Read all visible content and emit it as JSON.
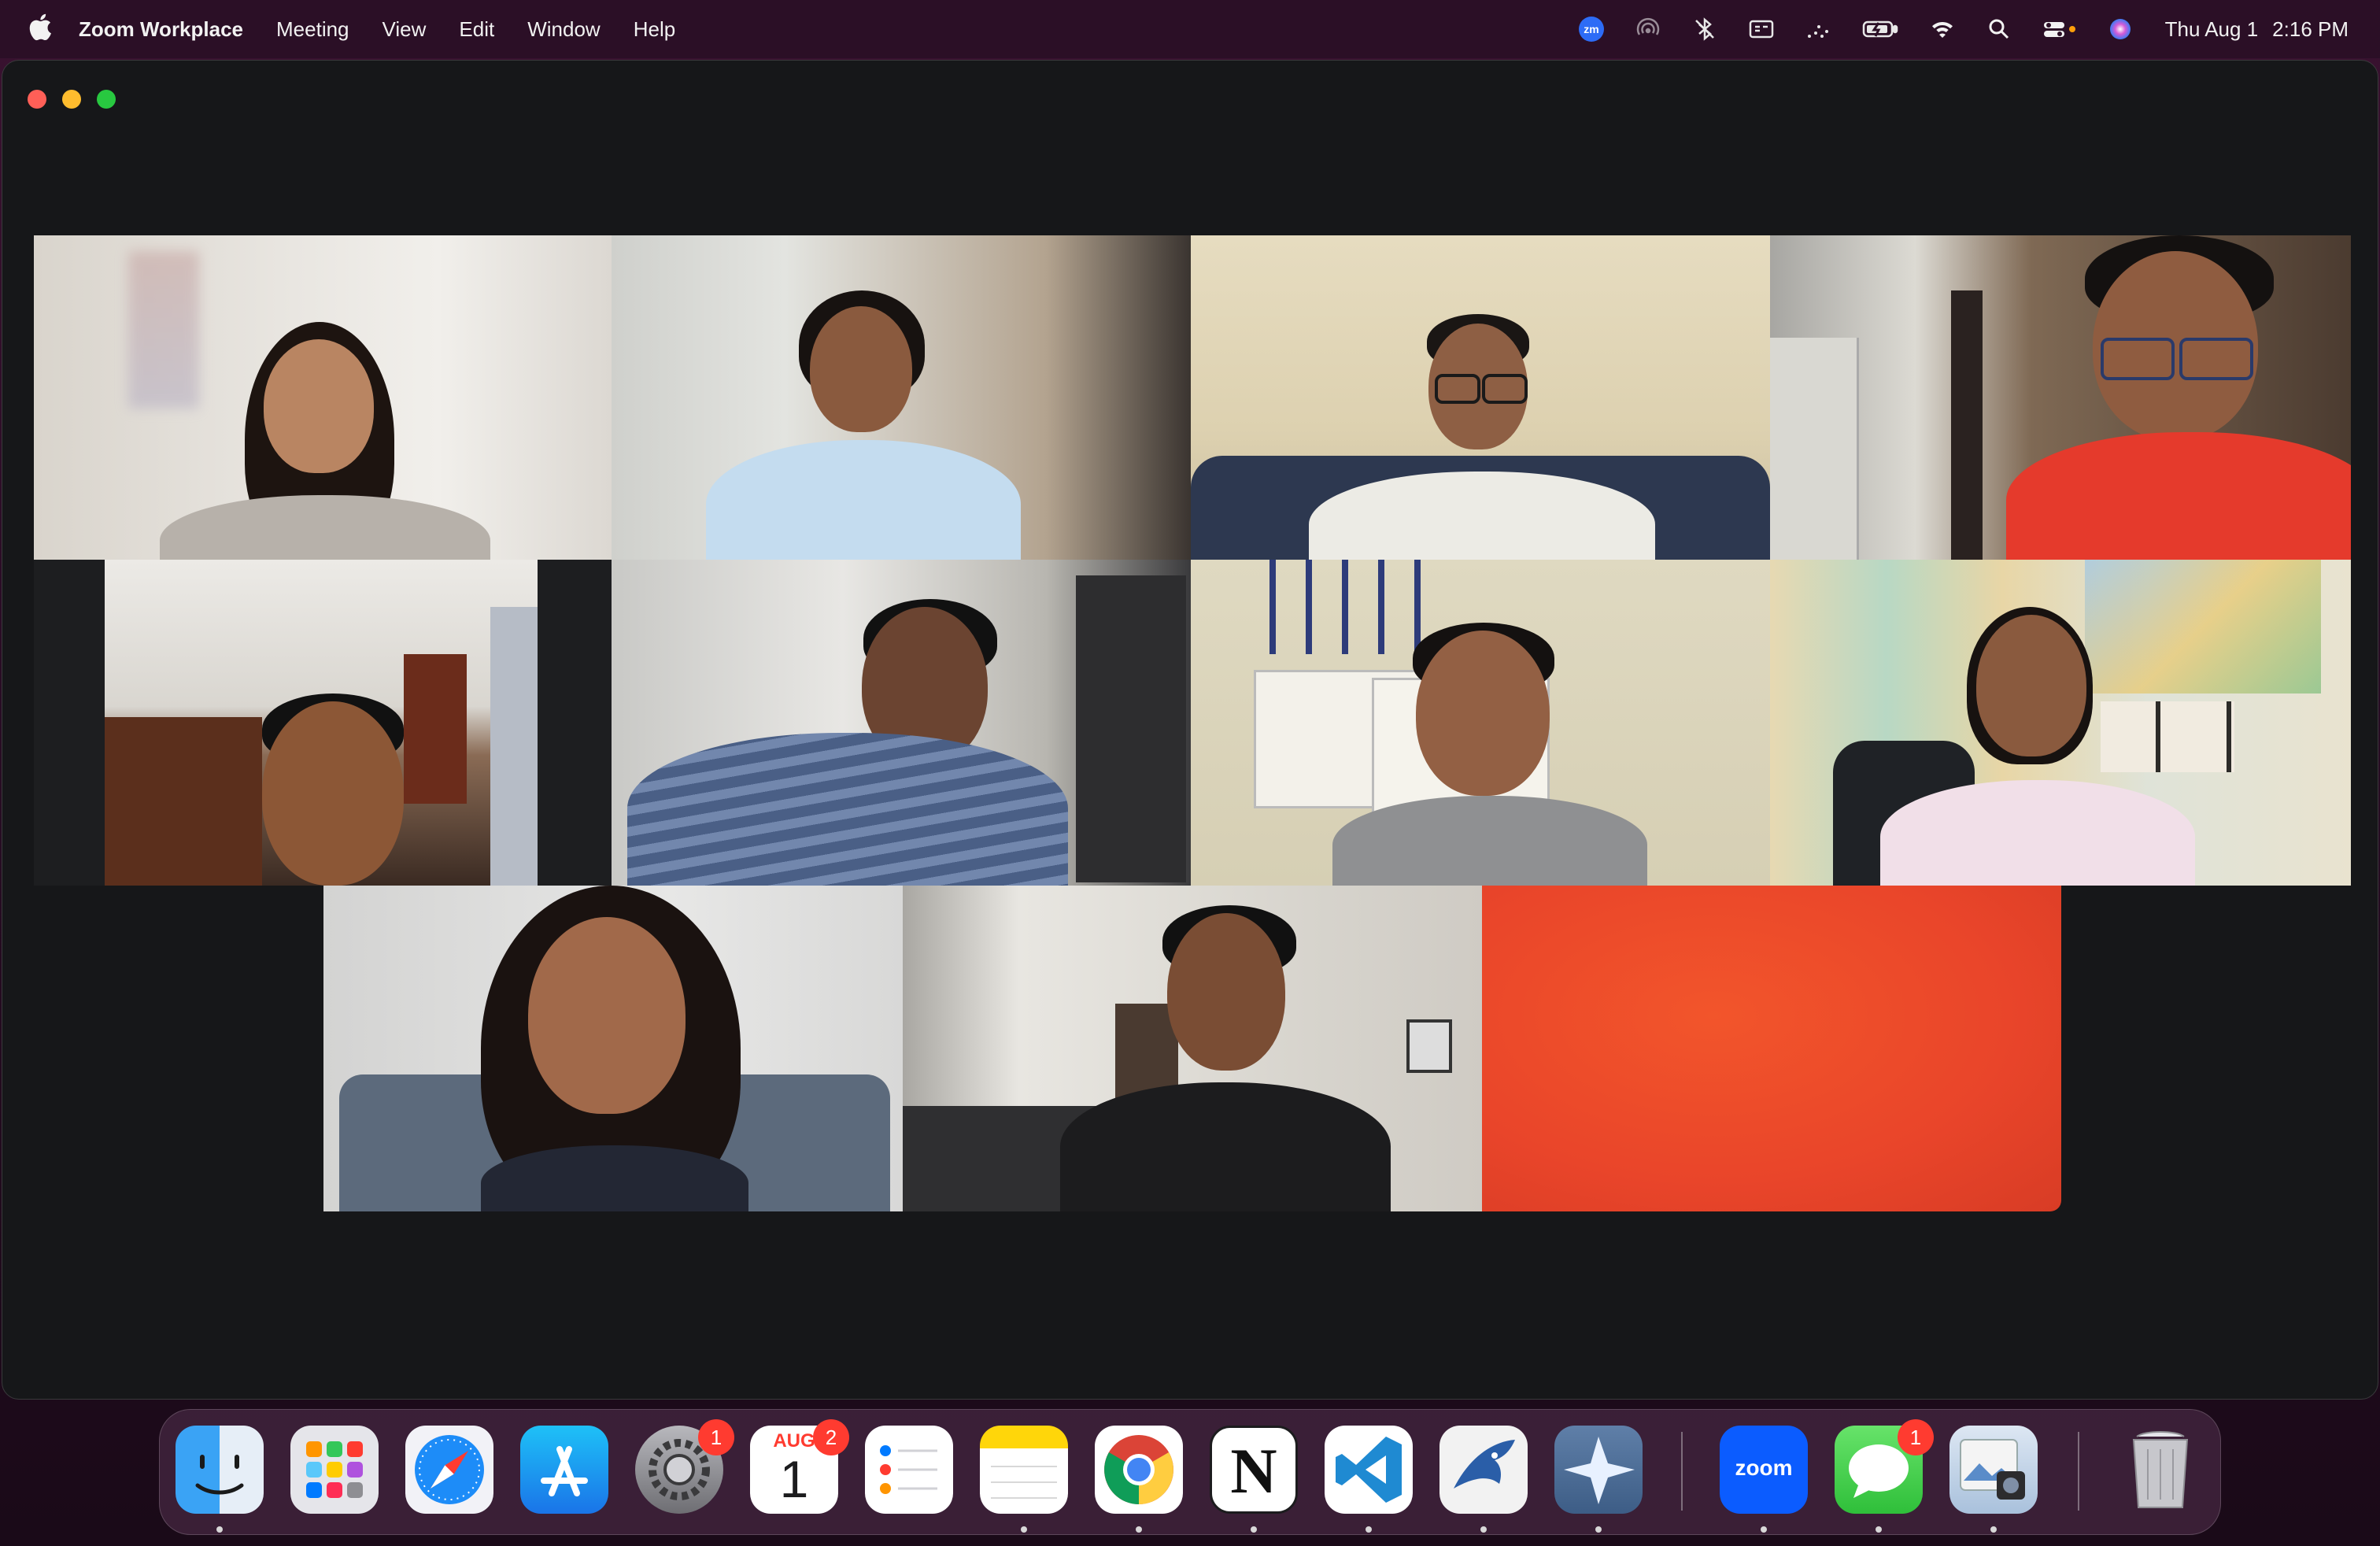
{
  "menubar": {
    "app_name": "Zoom Workplace",
    "menus": [
      "Meeting",
      "View",
      "Edit",
      "Window",
      "Help"
    ],
    "status_icons": [
      "zoom-status-icon",
      "airdrop-icon",
      "bluetooth-icon",
      "screen-mirror-icon",
      "stage-manager-icon",
      "battery-icon",
      "wifi-icon",
      "spotlight-icon",
      "control-center-icon",
      "siri-icon"
    ],
    "date": "Thu Aug 1",
    "time": "2:16 PM"
  },
  "gallery": {
    "participants": [
      {
        "id": "p1",
        "active": true
      },
      {
        "id": "p2",
        "active": false
      },
      {
        "id": "p3",
        "active": false
      },
      {
        "id": "p4",
        "active": false
      },
      {
        "id": "p5",
        "active": false
      },
      {
        "id": "p6",
        "active": false
      },
      {
        "id": "p7",
        "active": false
      },
      {
        "id": "p8",
        "active": false
      },
      {
        "id": "p9",
        "active": false
      },
      {
        "id": "p10",
        "active": false
      },
      {
        "id": "p11",
        "active": false
      }
    ]
  },
  "dock": {
    "apps": [
      {
        "name": "Finder",
        "icon": "finder-icon",
        "running": true
      },
      {
        "name": "Launchpad",
        "icon": "launchpad-icon",
        "running": false
      },
      {
        "name": "Safari",
        "icon": "safari-icon",
        "running": false
      },
      {
        "name": "App Store",
        "icon": "app-store-icon",
        "running": false
      },
      {
        "name": "System Settings",
        "icon": "system-settings-icon",
        "running": false,
        "badge": "1"
      },
      {
        "name": "Calendar",
        "icon": "calendar-icon",
        "running": false,
        "badge": "2",
        "month": "AUG",
        "day": "1"
      },
      {
        "name": "Reminders",
        "icon": "reminders-icon",
        "running": false
      },
      {
        "name": "Notes",
        "icon": "notes-icon",
        "running": true
      },
      {
        "name": "Google Chrome",
        "icon": "chrome-icon",
        "running": true
      },
      {
        "name": "Notion",
        "icon": "notion-icon",
        "running": true,
        "glyph": "N"
      },
      {
        "name": "Visual Studio Code",
        "icon": "vscode-icon",
        "running": true
      },
      {
        "name": "BlueJ",
        "icon": "bluej-icon",
        "running": true
      },
      {
        "name": "Spark",
        "icon": "spark-icon",
        "running": true
      },
      {
        "name": "Zoom",
        "icon": "zoom-icon",
        "running": true,
        "label": "zoom"
      },
      {
        "name": "Messages",
        "icon": "messages-icon",
        "running": true,
        "badge": "1"
      },
      {
        "name": "Preview",
        "icon": "preview-icon",
        "running": true
      },
      {
        "name": "Trash",
        "icon": "trash-icon",
        "running": false
      }
    ]
  },
  "colors": {
    "active_speaker": "#62d84e",
    "window_bg": "#161719",
    "menubar_bg": "#2b0f26"
  }
}
